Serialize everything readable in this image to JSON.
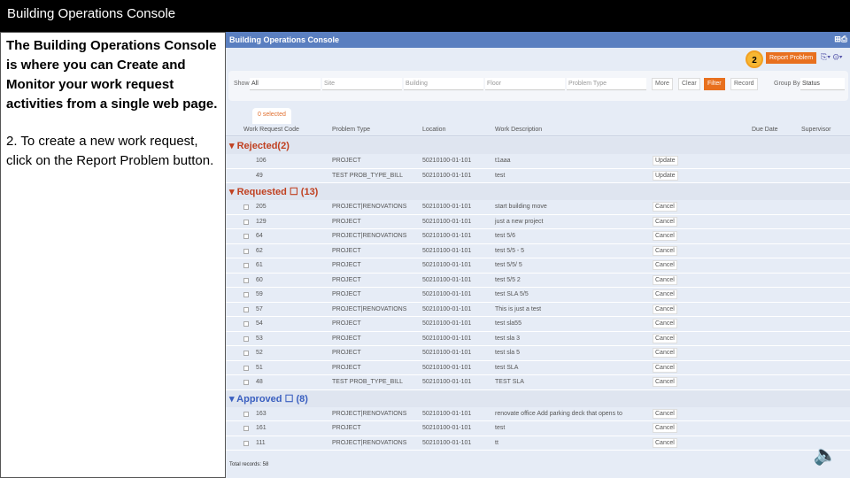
{
  "title": "Building Operations Console",
  "left": {
    "intro": "The Building Operations Console is where you can Create and Monitor your work request activities from a single web page.",
    "step": "2. To create a new work request, click on the Report Problem button."
  },
  "app": {
    "title": "Building Operations Console",
    "step_badge": "2",
    "report_problem": "Report Problem",
    "filter": {
      "show_label": "Show",
      "show_value": "All",
      "site": "Site",
      "building": "Building",
      "floor": "Floor",
      "problem_type": "Problem Type",
      "more": "More",
      "clear": "Clear",
      "filter": "Filter",
      "record": "Record",
      "group_by_label": "Group By",
      "group_by_value": "Status"
    },
    "selected": "0 selected",
    "columns": [
      "Work Request Code",
      "Problem Type",
      "Location",
      "Work Description",
      "Due Date",
      "Supervisor"
    ],
    "groups": [
      {
        "label": "Rejected(2)",
        "cls": "",
        "check": false,
        "rows": [
          [
            "106",
            "PROJECT",
            "50210100-01-101",
            "t1aaa",
            "Update"
          ],
          [
            "49",
            "TEST PROB_TYPE_BILL",
            "50210100-01-101",
            "test",
            "Update"
          ]
        ]
      },
      {
        "label": "Requested ☐ (13)",
        "cls": "",
        "check": true,
        "rows": [
          [
            "205",
            "PROJECT|RENOVATIONS",
            "50210100-01-101",
            "start building move",
            "Cancel"
          ],
          [
            "129",
            "PROJECT",
            "50210100-01-101",
            "just a new project",
            "Cancel"
          ],
          [
            "64",
            "PROJECT|RENOVATIONS",
            "50210100-01-101",
            "test 5/6",
            "Cancel"
          ],
          [
            "62",
            "PROJECT",
            "50210100-01-101",
            "test 5/5 - 5",
            "Cancel"
          ],
          [
            "61",
            "PROJECT",
            "50210100-01-101",
            "test 5/5/ 5",
            "Cancel"
          ],
          [
            "60",
            "PROJECT",
            "50210100-01-101",
            "test 5/5 2",
            "Cancel"
          ],
          [
            "59",
            "PROJECT",
            "50210100-01-101",
            "test SLA 5/5",
            "Cancel"
          ],
          [
            "57",
            "PROJECT|RENOVATIONS",
            "50210100-01-101",
            "This is just a test",
            "Cancel"
          ],
          [
            "54",
            "PROJECT",
            "50210100-01-101",
            "test sla55",
            "Cancel"
          ],
          [
            "53",
            "PROJECT",
            "50210100-01-101",
            "test sla 3",
            "Cancel"
          ],
          [
            "52",
            "PROJECT",
            "50210100-01-101",
            "test sla 5",
            "Cancel"
          ],
          [
            "51",
            "PROJECT",
            "50210100-01-101",
            "test SLA",
            "Cancel"
          ],
          [
            "48",
            "TEST PROB_TYPE_BILL",
            "50210100-01-101",
            "TEST SLA",
            "Cancel"
          ]
        ]
      },
      {
        "label": "Approved ☐ (8)",
        "cls": "ap",
        "check": true,
        "rows": [
          [
            "163",
            "PROJECT|RENOVATIONS",
            "50210100-01-101",
            "renovate office Add parking deck that opens to",
            "Cancel"
          ],
          [
            "161",
            "PROJECT",
            "50210100-01-101",
            "test",
            "Cancel"
          ],
          [
            "111",
            "PROJECT|RENOVATIONS",
            "50210100-01-101",
            "tt",
            "Cancel"
          ]
        ]
      }
    ],
    "total": "Total records: 58"
  }
}
